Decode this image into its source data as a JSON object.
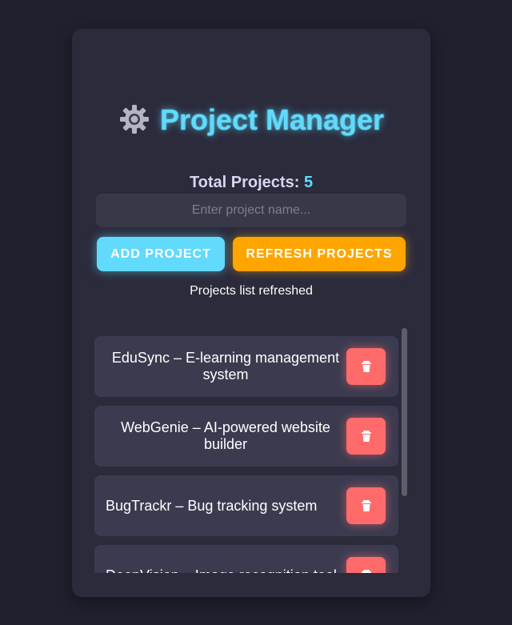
{
  "app": {
    "title": "Project Manager",
    "icon": "gear-icon"
  },
  "stats": {
    "total_label": "Total Projects:",
    "total_count": "5"
  },
  "form": {
    "placeholder": "Enter project name...",
    "add_label": "ADD PROJECT",
    "refresh_label": "REFRESH PROJECTS"
  },
  "status": {
    "message": "Projects list refreshed"
  },
  "projects": [
    {
      "text": "EduSync – E-learning management system",
      "align": "center"
    },
    {
      "text": "WebGenie – AI-powered website builder",
      "align": "center"
    },
    {
      "text": "BugTrackr – Bug tracking system",
      "align": "left"
    },
    {
      "text": "DeepVision – Image recognition tool",
      "align": "left"
    }
  ],
  "colors": {
    "accent": "#61dafb",
    "refresh": "#ffa500",
    "delete": "#ff6b6b",
    "card": "#2b2b3c",
    "background": "#20202e"
  },
  "delete_icon": "trash-icon"
}
